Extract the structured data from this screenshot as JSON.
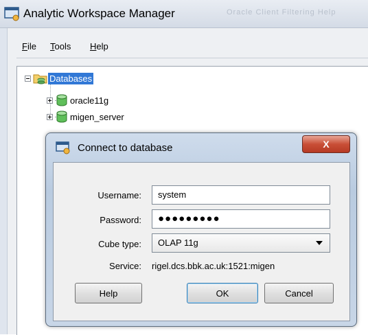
{
  "window": {
    "title": "Analytic Workspace Manager",
    "title_ghost": "Oracle  Client  Filtering  Help"
  },
  "menu": [
    {
      "label": "File",
      "mnemonic": "F"
    },
    {
      "label": "Tools",
      "mnemonic": "T"
    },
    {
      "label": "Help",
      "mnemonic": "H"
    }
  ],
  "tree": {
    "root": {
      "label": "Databases",
      "expanded": true,
      "selected": true
    },
    "children": [
      {
        "label": "oracle11g",
        "expanded": false
      },
      {
        "label": "migen_server",
        "expanded": false
      }
    ]
  },
  "dialog": {
    "title": "Connect to database",
    "close_glyph": "X",
    "username_label": "Username:",
    "username_value": "system",
    "password_label": "Password:",
    "password_mask": "●●●●●●●●●",
    "cube_type_label": "Cube type:",
    "cube_type_value": "OLAP 11g",
    "service_label": "Service:",
    "service_value": "rigel.dcs.bbk.ac.uk:1521:migen",
    "help_button": "Help",
    "ok_button": "OK",
    "cancel_button": "Cancel"
  },
  "colors": {
    "selection": "#3178d6",
    "close_button": "#c94f37",
    "dialog_frame": "#b9cbe0"
  }
}
